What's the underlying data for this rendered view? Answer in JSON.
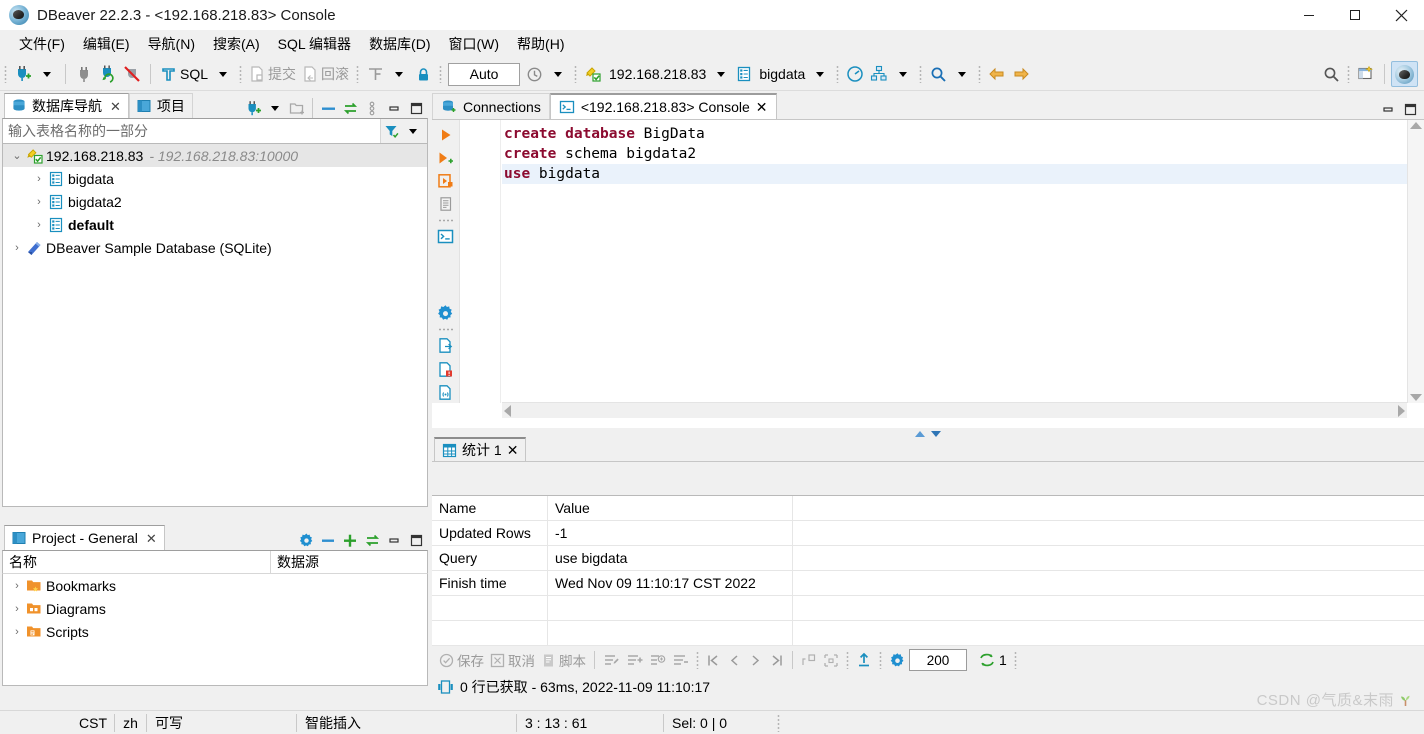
{
  "window": {
    "title": "DBeaver 22.2.3 - <192.168.218.83> Console",
    "app_icon": "dbeaver-icon",
    "minimize": "minimize-icon",
    "maximize": "maximize-icon",
    "close": "close-icon"
  },
  "menu": {
    "items": [
      {
        "label": "文件(F)"
      },
      {
        "label": "编辑(E)"
      },
      {
        "label": "导航(N)"
      },
      {
        "label": "搜索(A)"
      },
      {
        "label": "SQL 编辑器"
      },
      {
        "label": "数据库(D)"
      },
      {
        "label": "窗口(W)"
      },
      {
        "label": "帮助(H)"
      }
    ]
  },
  "toolbar": {
    "new_connection": "new-connection-icon",
    "new_connection_caret": "chevron-down-icon",
    "disconnect": "disconnect-icon",
    "refresh_connection": "refresh-connection-icon",
    "disconnect_all": "disconnect-all-icon",
    "sql_label": "SQL",
    "sql_caret": "chevron-down-icon",
    "commit_label": "提交",
    "rollback_label": "回滚",
    "tx_mode_caret": "chevron-down-icon",
    "lock_icon": "lock-icon",
    "auto_value": "Auto",
    "history_icon": "history-icon",
    "connection_name": "192.168.218.83",
    "database_name": "bigdata",
    "dashboard_icon": "dashboard-icon",
    "er_diagram_icon": "er-diagram-icon",
    "search_icon": "search-icon",
    "back_icon": "back-arrow-icon",
    "forward_icon": "forward-arrow-icon",
    "global_search_icon": "search-icon",
    "open_perspective_icon": "open-perspective-icon",
    "perspective_icon": "dbeaver-perspective-icon"
  },
  "navigator": {
    "tabs": [
      {
        "label": "数据库导航",
        "icon": "database-navigator-icon",
        "active": true,
        "closable": true
      },
      {
        "label": "项目",
        "icon": "projects-icon",
        "active": false,
        "closable": false
      }
    ],
    "tools": [
      "new-connection-icon",
      "chevron-down-icon",
      "new-folder-icon",
      "collapse-all-icon",
      "link-with-editor-icon",
      "view-menu-icon",
      "minimize-icon",
      "maximize-icon"
    ],
    "filter_placeholder": "输入表格名称的一部分",
    "filter_value": "",
    "filter_icon": "filter-icon",
    "filter_caret": "chevron-down-icon",
    "tree": [
      {
        "label": "192.168.218.83",
        "suffix": "- 192.168.218.83:10000",
        "icon": "connection-icon",
        "expanded": true,
        "selected": true,
        "indent": 0,
        "bold": false
      },
      {
        "label": "bigdata",
        "suffix": "",
        "icon": "schema-icon",
        "expanded": false,
        "selected": false,
        "indent": 1,
        "bold": false
      },
      {
        "label": "bigdata2",
        "suffix": "",
        "icon": "schema-icon",
        "expanded": false,
        "selected": false,
        "indent": 1,
        "bold": false
      },
      {
        "label": "default",
        "suffix": "",
        "icon": "schema-icon",
        "expanded": false,
        "selected": false,
        "indent": 1,
        "bold": true
      },
      {
        "label": "DBeaver Sample Database (SQLite)",
        "suffix": "",
        "icon": "sqlite-icon",
        "expanded": false,
        "selected": false,
        "indent": 0,
        "bold": false
      }
    ]
  },
  "project_panel": {
    "tab_label": "Project - General",
    "tab_icon": "project-icon",
    "tools": [
      "settings-icon",
      "collapse-all-icon",
      "expand-all-icon",
      "link-with-editor-icon",
      "minimize-icon",
      "maximize-icon"
    ],
    "columns": [
      "名称",
      "数据源"
    ],
    "rows": [
      {
        "name": "Bookmarks",
        "datasource": "",
        "icon": "bookmarks-folder-icon"
      },
      {
        "name": "Diagrams",
        "datasource": "",
        "icon": "diagrams-folder-icon"
      },
      {
        "name": "Scripts",
        "datasource": "",
        "icon": "scripts-folder-icon"
      }
    ]
  },
  "editor": {
    "tabs": [
      {
        "label": "Connections",
        "icon": "connections-icon",
        "active": false,
        "closable": false
      },
      {
        "label": "<192.168.218.83> Console",
        "icon": "console-icon",
        "active": true,
        "closable": true
      }
    ],
    "panel_minimize": "minimize-icon",
    "panel_maximize": "maximize-icon",
    "vertical_tools": [
      "execute-statement-icon",
      "execute-script-icon",
      "execute-new-tab-icon",
      "explain-plan-icon",
      "separator",
      "open-console-icon",
      "settings-icon",
      "separator2",
      "export-data-icon",
      "export-error-icon",
      "export-script-icon"
    ],
    "code_lines": [
      {
        "tokens": [
          {
            "t": "create database",
            "k": true
          },
          {
            "t": " BigData",
            "k": false
          }
        ],
        "highlighted": false
      },
      {
        "tokens": [
          {
            "t": "create",
            "k": true
          },
          {
            "t": " schema bigdata2",
            "k": false
          }
        ],
        "highlighted": false
      },
      {
        "tokens": [
          {
            "t": "use",
            "k": true
          },
          {
            "t": " bigdata",
            "k": false
          }
        ],
        "highlighted": true
      }
    ]
  },
  "results": {
    "tab_label": "统计 1",
    "tab_icon": "statistics-icon",
    "columns": [
      "Name",
      "Value",
      ""
    ],
    "rows": [
      {
        "name": "Updated Rows",
        "value": "-1"
      },
      {
        "name": "Query",
        "value": "use bigdata"
      },
      {
        "name": "Finish time",
        "value": "Wed Nov 09 11:10:17 CST 2022"
      },
      {
        "name": "",
        "value": ""
      },
      {
        "name": "",
        "value": ""
      }
    ],
    "toolbar": {
      "save_label": "保存",
      "cancel_label": "取消",
      "script_label": "脚本",
      "save_icon": "save-icon",
      "cancel_icon": "cancel-icon",
      "script_icon": "script-icon",
      "edit_row_icon": "edit-row-icon",
      "add_row_icon": "add-row-icon",
      "duplicate_row_icon": "duplicate-row-icon",
      "delete_row_icon": "delete-row-icon",
      "first_row_icon": "first-row-icon",
      "prev_row_icon": "prev-row-icon",
      "next_row_icon": "next-row-icon",
      "last_row_icon": "last-row-icon",
      "calc_icon": "calc-icon",
      "panels_icon": "panels-icon",
      "export_icon": "export-icon",
      "settings_icon": "settings-icon",
      "fetch_size": "200",
      "refresh_icon": "refresh-icon",
      "refresh_count": "1"
    },
    "status_icon": "grid-status-icon",
    "status_text": "0 行已获取 - 63ms, 2022-11-09 11:10:17"
  },
  "statusbar": {
    "timezone": "CST",
    "language": "zh",
    "writable": "可写",
    "insert_mode": "智能插入",
    "position": "3 : 13 : 61",
    "selection": "Sel: 0 | 0"
  },
  "watermark": {
    "text": "CSDN @气质&末雨",
    "icon": "sprout-icon"
  },
  "colors": {
    "keyword": "#8c0b30",
    "accent_blue": "#2e75b6",
    "selection": "#eaf2fb",
    "tree_selected": "#e6e6e6"
  }
}
